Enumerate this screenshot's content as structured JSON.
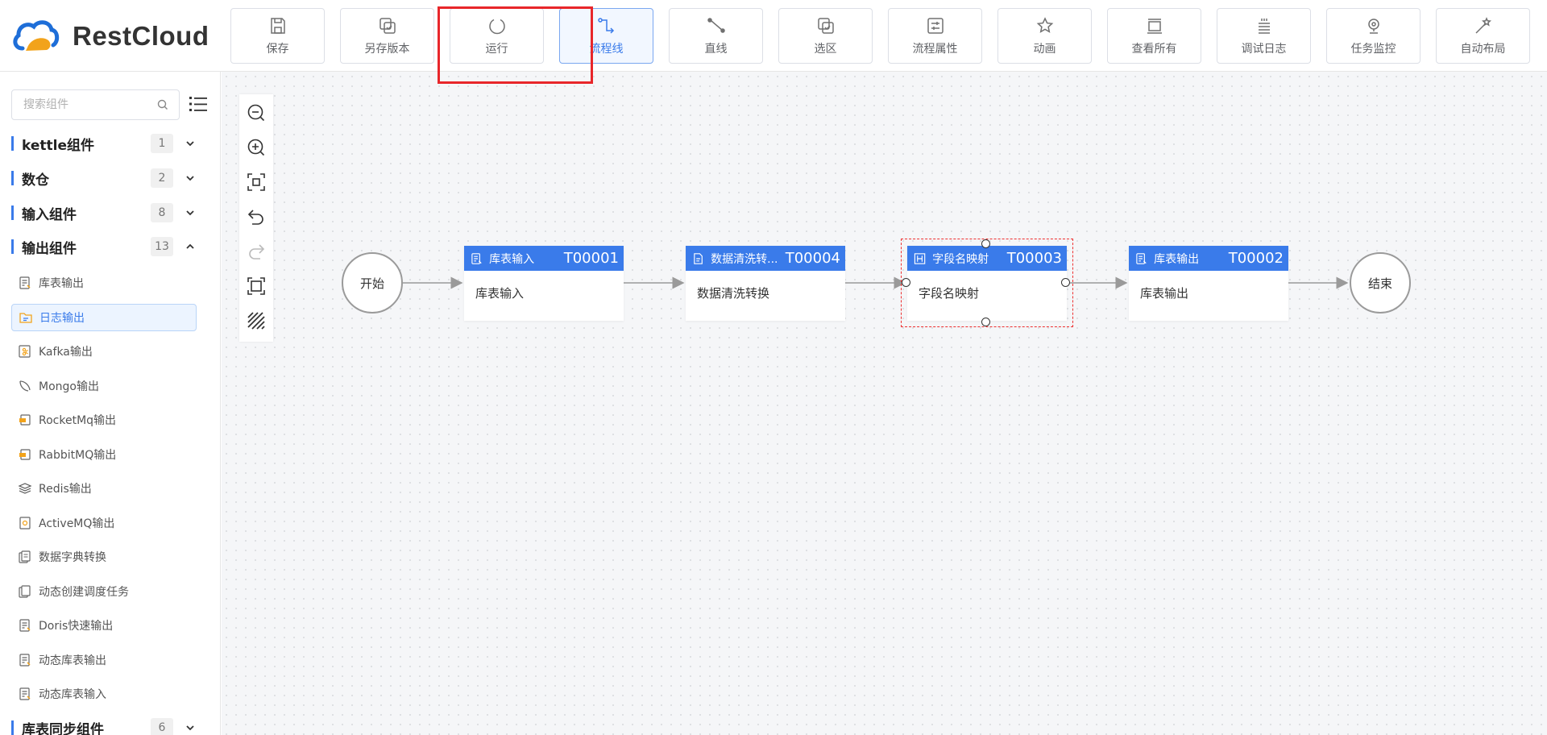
{
  "app": {
    "name": "RestCloud"
  },
  "toolbar": [
    {
      "key": "save",
      "label": "保存",
      "icon": "save-icon"
    },
    {
      "key": "save-version",
      "label": "另存版本",
      "icon": "copy-check-icon"
    },
    {
      "key": "run",
      "label": "运行",
      "icon": "run-circle-icon"
    },
    {
      "key": "flow-line",
      "label": "流程线",
      "icon": "flow-line-icon",
      "active": true
    },
    {
      "key": "straight-line",
      "label": "直线",
      "icon": "straight-line-icon"
    },
    {
      "key": "select-area",
      "label": "选区",
      "icon": "select-area-icon"
    },
    {
      "key": "flow-props",
      "label": "流程属性",
      "icon": "sliders-icon"
    },
    {
      "key": "animation",
      "label": "动画",
      "icon": "star-icon"
    },
    {
      "key": "view-all",
      "label": "查看所有",
      "icon": "view-all-icon"
    },
    {
      "key": "debug-log",
      "label": "调试日志",
      "icon": "log-icon"
    },
    {
      "key": "task-monitor",
      "label": "任务监控",
      "icon": "monitor-icon"
    },
    {
      "key": "auto-layout",
      "label": "自动布局",
      "icon": "magic-wand-icon"
    }
  ],
  "sidebar": {
    "search_placeholder": "搜索组件",
    "categories": [
      {
        "name": "kettle组件",
        "count": "1",
        "expanded": false
      },
      {
        "name": "数仓",
        "count": "2",
        "expanded": false
      },
      {
        "name": "输入组件",
        "count": "8",
        "expanded": false
      },
      {
        "name": "输出组件",
        "count": "13",
        "expanded": true
      },
      {
        "name": "库表同步组件",
        "count": "6",
        "expanded": false
      }
    ],
    "items": [
      {
        "name": "库表输出",
        "icon": "table-output-icon"
      },
      {
        "name": "日志输出",
        "icon": "log-output-icon",
        "selected": true
      },
      {
        "name": "Kafka输出",
        "icon": "kafka-icon"
      },
      {
        "name": "Mongo输出",
        "icon": "mongo-icon"
      },
      {
        "name": "RocketMq输出",
        "icon": "rocketmq-icon"
      },
      {
        "name": "RabbitMQ输出",
        "icon": "rabbitmq-icon"
      },
      {
        "name": "Redis输出",
        "icon": "redis-icon"
      },
      {
        "name": "ActiveMQ输出",
        "icon": "activemq-icon"
      },
      {
        "name": "数据字典转换",
        "icon": "dictionary-icon"
      },
      {
        "name": "动态创建调度任务",
        "icon": "schedule-icon"
      },
      {
        "name": "Doris快速输出",
        "icon": "doris-icon"
      },
      {
        "name": "动态库表输出",
        "icon": "dynamic-table-output-icon"
      },
      {
        "name": "动态库表输入",
        "icon": "dynamic-table-input-icon"
      }
    ]
  },
  "canvas": {
    "start_label": "开始",
    "end_label": "结束",
    "tasks": [
      {
        "title": "库表输入",
        "id": "T00001",
        "body": "库表输入",
        "icon": "table-input-icon"
      },
      {
        "title": "数据清洗转...",
        "id": "T00004",
        "body": "数据清洗转换",
        "icon": "doc-icon"
      },
      {
        "title": "字段名映射",
        "id": "T00003",
        "body": "字段名映射",
        "icon": "field-map-icon",
        "selected": true
      },
      {
        "title": "库表输出",
        "id": "T00002",
        "body": "库表输出",
        "icon": "table-output-icon"
      }
    ]
  },
  "colors": {
    "accent": "#3a7bea",
    "highlight": "#e8262a",
    "selection": "#ee3030"
  }
}
